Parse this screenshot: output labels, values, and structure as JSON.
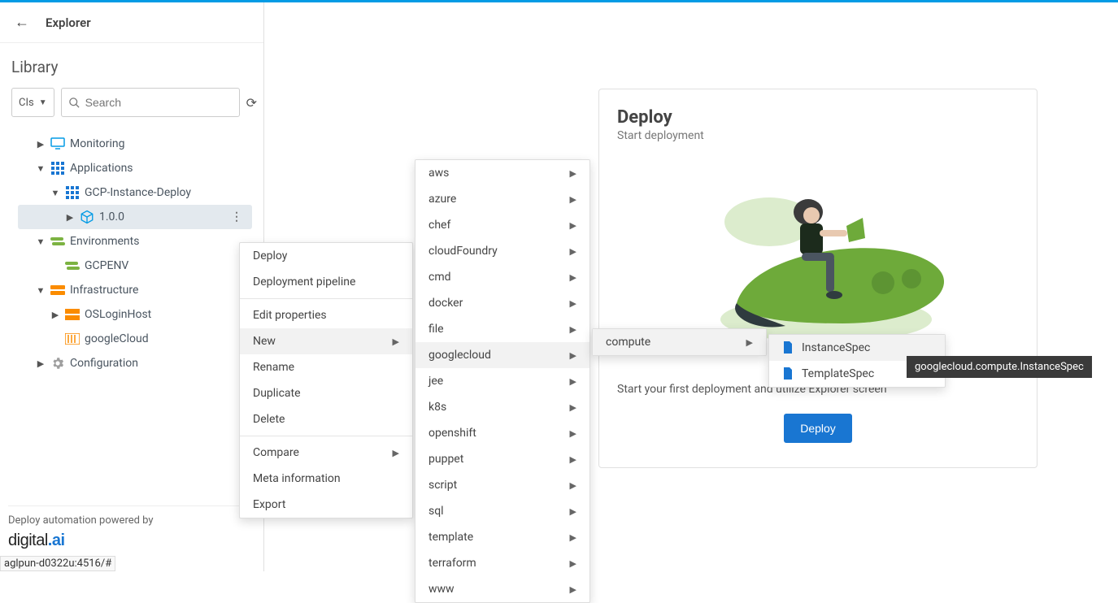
{
  "header": {
    "title": "Explorer"
  },
  "library": {
    "title": "Library",
    "cls_label": "CIs",
    "search_placeholder": "Search"
  },
  "tree": {
    "monitoring": "Monitoring",
    "applications": "Applications",
    "gcp_instance_deploy": "GCP-Instance-Deploy",
    "version": "1.0.0",
    "environments": "Environments",
    "gcpenv": "GCPENV",
    "infrastructure": "Infrastructure",
    "osloginhost": "OSLoginHost",
    "googlecloud": "googleCloud",
    "configuration": "Configuration"
  },
  "context1": {
    "deploy": "Deploy",
    "pipeline": "Deployment pipeline",
    "edit": "Edit properties",
    "new": "New",
    "rename": "Rename",
    "duplicate": "Duplicate",
    "delete": "Delete",
    "compare": "Compare",
    "meta": "Meta information",
    "export": "Export"
  },
  "context2": {
    "aws": "aws",
    "azure": "azure",
    "chef": "chef",
    "cloudfoundry": "cloudFoundry",
    "cmd": "cmd",
    "docker": "docker",
    "file": "file",
    "googlecloud": "googlecloud",
    "jee": "jee",
    "k8s": "k8s",
    "openshift": "openshift",
    "puppet": "puppet",
    "script": "script",
    "sql": "sql",
    "template": "template",
    "terraform": "terraform",
    "www": "www"
  },
  "context3": {
    "compute": "compute"
  },
  "context4": {
    "instance_spec": "InstanceSpec",
    "template_spec": "TemplateSpec"
  },
  "tooltip": "googlecloud.compute.InstanceSpec",
  "deploy_card": {
    "title": "Deploy",
    "subtitle": "Start deployment",
    "body": "Start your first deployment and utilize Explorer screen",
    "button": "Deploy"
  },
  "footer": {
    "text": "Deploy automation powered by",
    "brand_a": "digital",
    "brand_b": ".ai"
  },
  "status_url": "aglpun-d0322u:4516/#"
}
